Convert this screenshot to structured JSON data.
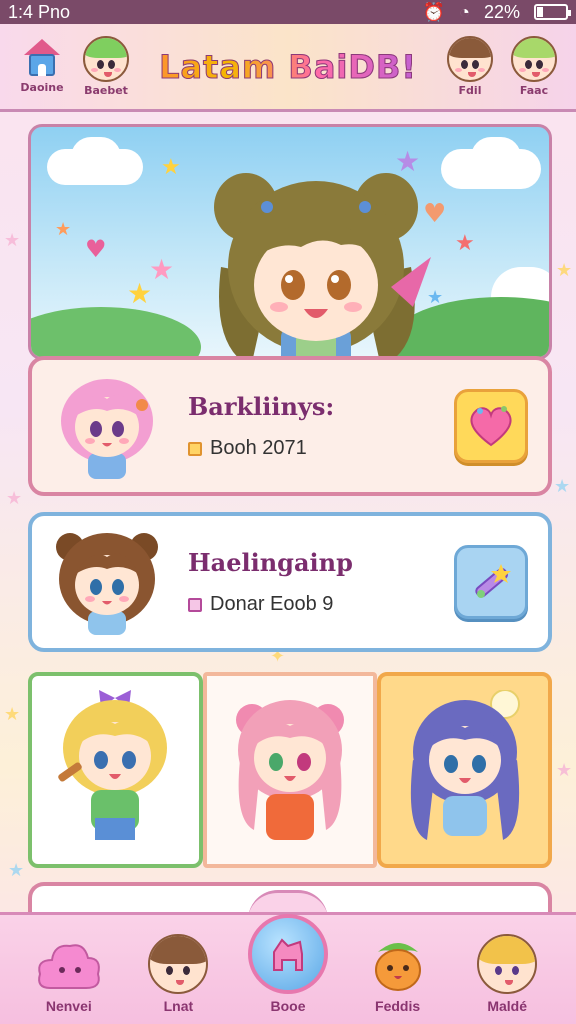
{
  "status_bar": {
    "time": "1:4 Pno",
    "battery": "22%",
    "battery_level": 0.22
  },
  "header": {
    "title": "Latam BaiDB!",
    "left_items": [
      {
        "label": "Daoine",
        "icon": "home-icon"
      },
      {
        "label": "Baebet",
        "icon": "avatar-green"
      }
    ],
    "right_items": [
      {
        "label": "Fdil",
        "icon": "avatar-brown"
      },
      {
        "label": "Faac",
        "icon": "avatar-green-2"
      }
    ]
  },
  "cards": [
    {
      "name": "Barkliinys:",
      "subtitle": "Booh 2071",
      "action_icon": "heart-icon"
    },
    {
      "name": "Haelingainp",
      "subtitle": "Donar Eoob 9",
      "action_icon": "wand-icon"
    }
  ],
  "bottom_nav": [
    {
      "label": "Nenvei",
      "icon": "cloud-icon"
    },
    {
      "label": "Lnat",
      "icon": "bear-avatar"
    },
    {
      "label": "Booe",
      "icon": "horse-icon"
    },
    {
      "label": "Feddis",
      "icon": "fruit-icon"
    },
    {
      "label": "Maldé",
      "icon": "blonde-avatar"
    }
  ],
  "colors": {
    "accent": "#d985a3",
    "brand_purple": "#7b2d6e",
    "sky": "#8fd0f2"
  }
}
